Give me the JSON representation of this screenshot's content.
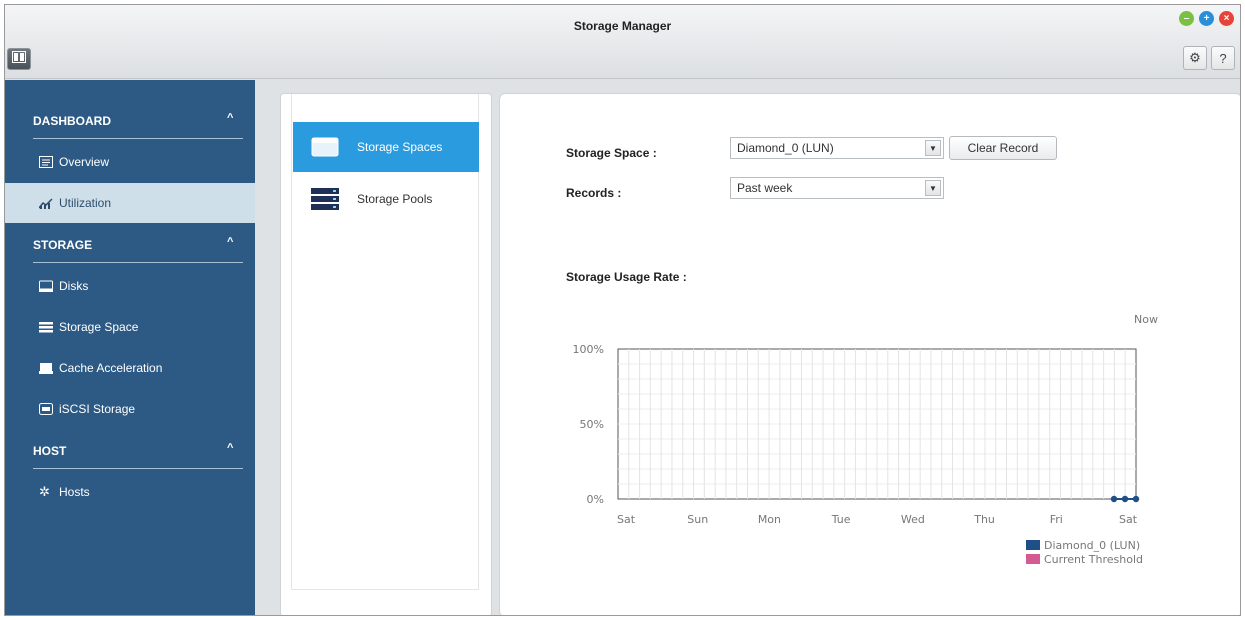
{
  "window": {
    "title": "Storage Manager"
  },
  "toolbar": {
    "settings_icon": "gear-icon",
    "help_label": "?"
  },
  "window_controls": [
    {
      "name": "minimize",
      "color": "#7cc043",
      "glyph": "–"
    },
    {
      "name": "maximize",
      "color": "#2a8fd8",
      "glyph": "+"
    },
    {
      "name": "close",
      "color": "#e5443a",
      "glyph": "×"
    }
  ],
  "sidebar": {
    "sections": [
      {
        "label": "DASHBOARD",
        "items": [
          {
            "label": "Overview",
            "icon": "overview-icon"
          },
          {
            "label": "Utilization",
            "icon": "utilization-icon",
            "active": true
          }
        ]
      },
      {
        "label": "STORAGE",
        "items": [
          {
            "label": "Disks",
            "icon": "disk-icon"
          },
          {
            "label": "Storage Space",
            "icon": "storage-space-icon"
          },
          {
            "label": "Cache Acceleration",
            "icon": "cache-icon"
          },
          {
            "label": "iSCSI Storage",
            "icon": "iscsi-icon"
          }
        ]
      },
      {
        "label": "HOST",
        "items": [
          {
            "label": "Hosts",
            "icon": "gear-icon"
          }
        ]
      }
    ]
  },
  "subnav": {
    "items": [
      {
        "label": "Storage Spaces",
        "active": true
      },
      {
        "label": "Storage Pools",
        "active": false
      }
    ]
  },
  "form": {
    "storage_space_label": "Storage Space :",
    "storage_space_value": "Diamond_0 (LUN)",
    "clear_record_label": "Clear Record",
    "records_label": "Records :",
    "records_value": "Past week"
  },
  "chart_title": "Storage Usage Rate :",
  "chart_data": {
    "type": "line",
    "x": [
      "Sat",
      "Sun",
      "Mon",
      "Tue",
      "Wed",
      "Thu",
      "Fri",
      "Sat"
    ],
    "now_label": "Now",
    "yticks": [
      "100%",
      "50%",
      "0%"
    ],
    "ylim": [
      0,
      100
    ],
    "grid": true,
    "legend_position": "bottom-right",
    "series": [
      {
        "name": "Diamond_0 (LUN)",
        "color": "#1e4f86",
        "points": [
          {
            "x": "Fri",
            "y": 0
          },
          {
            "x": "Sat",
            "y": 0
          },
          {
            "x": "Now",
            "y": 0
          }
        ]
      },
      {
        "name": "Current Threshold",
        "color": "#d45a93",
        "points": []
      }
    ]
  }
}
